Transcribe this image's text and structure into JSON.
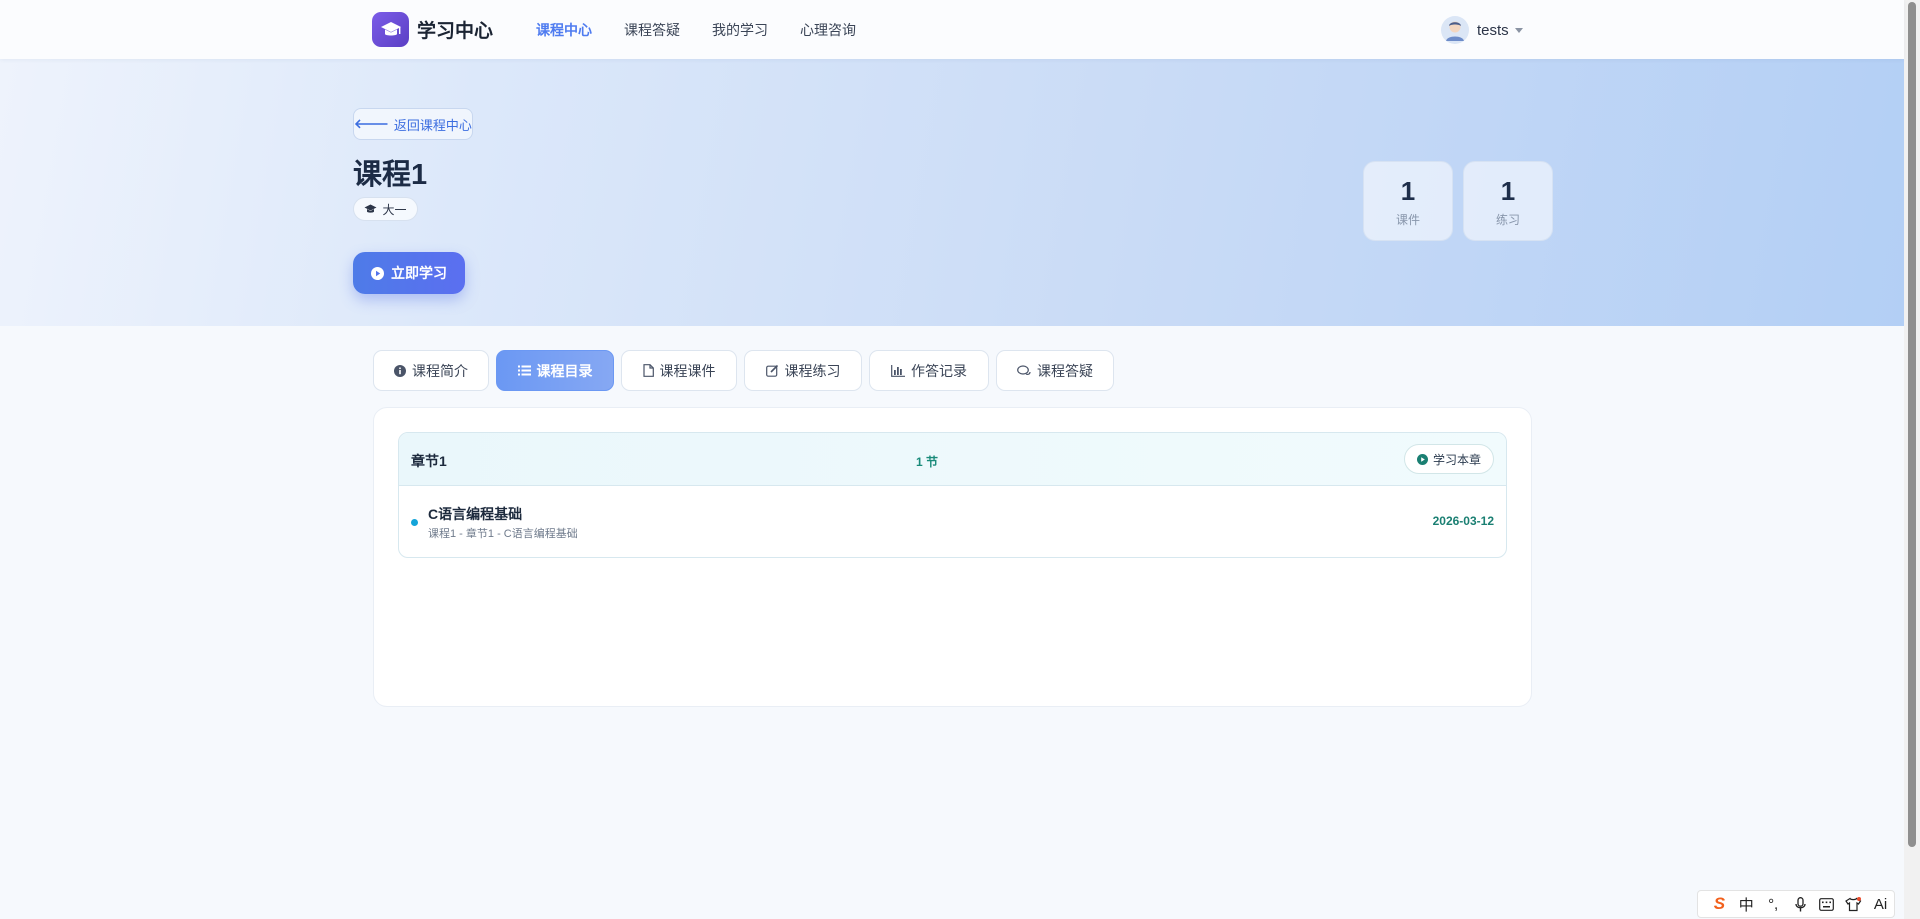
{
  "header": {
    "brand": "学习中心",
    "nav": [
      "课程中心",
      "课程答疑",
      "我的学习",
      "心理咨询"
    ],
    "active_nav": "课程中心",
    "username": "tests"
  },
  "hero": {
    "back_label": "返回课程中心",
    "course_title": "课程1",
    "grade_tag": "大一",
    "study_button": "立即学习",
    "stats": [
      {
        "value": "1",
        "label": "课件"
      },
      {
        "value": "1",
        "label": "练习"
      }
    ]
  },
  "tabs": [
    {
      "label": "课程简介",
      "icon": "info-icon"
    },
    {
      "label": "课程目录",
      "icon": "list-icon"
    },
    {
      "label": "课程课件",
      "icon": "file-icon"
    },
    {
      "label": "课程练习",
      "icon": "edit-icon"
    },
    {
      "label": "作答记录",
      "icon": "chart-icon"
    },
    {
      "label": "课程答疑",
      "icon": "chat-icon"
    }
  ],
  "active_tab": "课程目录",
  "catalog": {
    "chapters": [
      {
        "title": "章节1",
        "count": "1 节",
        "study_label": "学习本章",
        "lessons": [
          {
            "title": "C语言编程基础",
            "path": "课程1 - 章节1 - C语言编程基础",
            "date": "2026-03-12"
          }
        ]
      }
    ]
  },
  "ime": {
    "items": [
      "S",
      "中",
      "°,",
      "mic-icon",
      "keyboard-icon",
      "shirt-icon",
      "Ai"
    ]
  },
  "colors": {
    "accent": "#4f7cf0",
    "teal": "#1a8b7a",
    "dot": "#14a4d9"
  }
}
